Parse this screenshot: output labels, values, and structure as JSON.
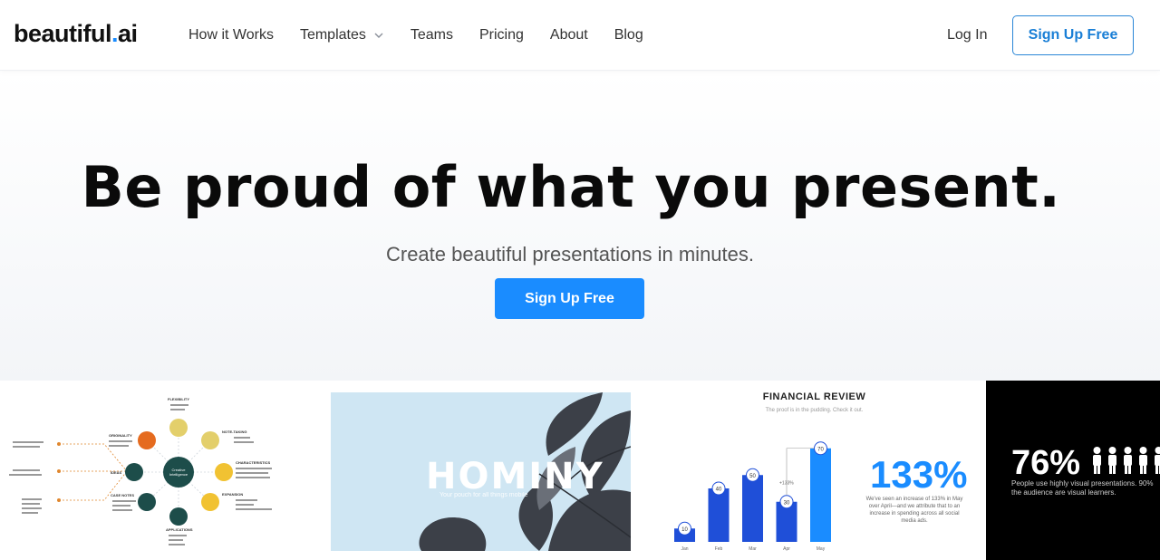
{
  "nav": {
    "logo_main": "beautiful",
    "logo_dot": ".",
    "logo_ai": "ai",
    "items": [
      {
        "label": "How it Works"
      },
      {
        "label": "Templates",
        "has_dropdown": true
      },
      {
        "label": "Teams"
      },
      {
        "label": "Pricing"
      },
      {
        "label": "About"
      },
      {
        "label": "Blog"
      }
    ],
    "login": "Log In",
    "signup": "Sign Up Free"
  },
  "hero": {
    "headline": "Be proud of what you present.",
    "subheadline": "Create beautiful presentations in minutes.",
    "cta": "Sign Up Free"
  },
  "cards": {
    "mindmap": {
      "center": "Creative Intelligence",
      "nodes": [
        "FLEXIBILITY",
        "NOTE-TAKING",
        "CHARACTERISTICS",
        "EXPANSION",
        "APPLICATIONS",
        "CASE NOTES",
        "IDEAS",
        "ORIGINALITY"
      ]
    },
    "hominy": {
      "title": "HOMINY",
      "subtitle": "Your pouch for all things mobile"
    },
    "financial": {
      "title": "FINANCIAL REVIEW",
      "subtitle": "The proof is in the pudding. Check it out.",
      "big_stat": "133%",
      "stat_text": "We've seen an increase of 133% in May over April—and we attribute that to an increase in spending across all social media ads."
    },
    "audience": {
      "stat": "76%",
      "text_line1": "People use highly visual presentations. 90%",
      "text_line2": "the audience are visual learners."
    }
  },
  "chart_data": {
    "type": "bar",
    "categories": [
      "Jan",
      "Feb",
      "Mar",
      "Apr",
      "May"
    ],
    "values": [
      10,
      40,
      50,
      30,
      70
    ],
    "annotation": "+133%",
    "title": "FINANCIAL REVIEW",
    "ylim": [
      0,
      80
    ],
    "colors": [
      "#1f4fd8",
      "#1f4fd8",
      "#1f4fd8",
      "#1f4fd8",
      "#1a8cff"
    ]
  },
  "colors": {
    "brand_blue": "#1a8cff",
    "cta_outline": "#2a86d6",
    "headline": "#0a0a0a"
  }
}
